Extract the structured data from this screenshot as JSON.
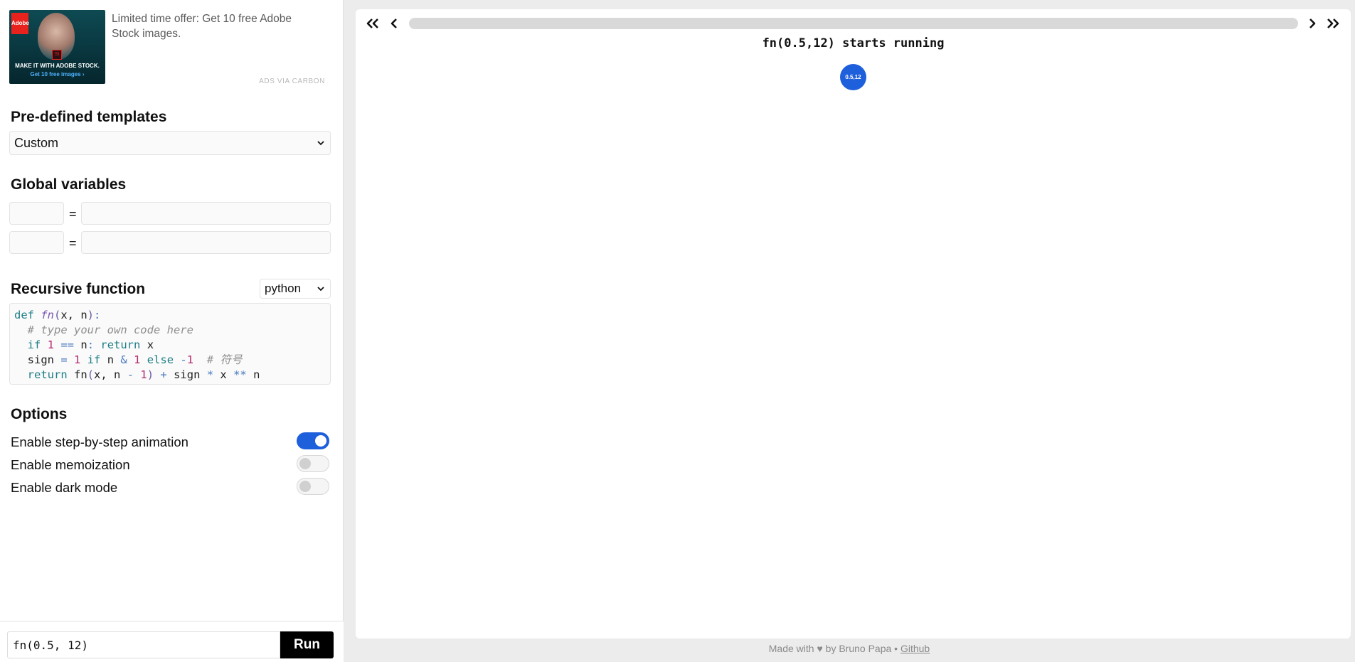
{
  "ad": {
    "image_line1": "MAKE IT WITH ADOBE STOCK.",
    "image_line2": "Get 10 free images ›",
    "logo_text": "Adobe",
    "badge_text": "St",
    "text": "Limited time offer: Get 10 free Adobe Stock images.",
    "via": "ADS VIA CARBON"
  },
  "templates": {
    "title": "Pre-defined templates",
    "selected": "Custom"
  },
  "globals": {
    "title": "Global variables",
    "rows": [
      {
        "name": "",
        "value": "",
        "eq": "="
      },
      {
        "name": "",
        "value": "",
        "eq": "="
      }
    ]
  },
  "recursive": {
    "title": "Recursive function",
    "language": "python",
    "code_lines": [
      "def fn(x, n):",
      "  # type your own code here",
      "  if 1 == n: return x",
      "  sign = 1 if n & 1 else -1  # 符号",
      "  return fn(x, n - 1) + sign * x ** n"
    ]
  },
  "options": {
    "title": "Options",
    "items": [
      {
        "label": "Enable step-by-step animation",
        "enabled": true
      },
      {
        "label": "Enable memoization",
        "enabled": false
      },
      {
        "label": "Enable dark mode",
        "enabled": false
      }
    ]
  },
  "run": {
    "call": "fn(0.5, 12)",
    "button": "Run"
  },
  "viewer": {
    "step_title": "fn(0.5,12) starts running",
    "node_label": "0.5,12",
    "node_color": "#1e5fdc"
  },
  "footer": {
    "prefix": "Made with ♥ by Bruno Papa • ",
    "link": "Github"
  },
  "colors": {
    "accent": "#1e5fdc",
    "run_button": "#000000"
  }
}
